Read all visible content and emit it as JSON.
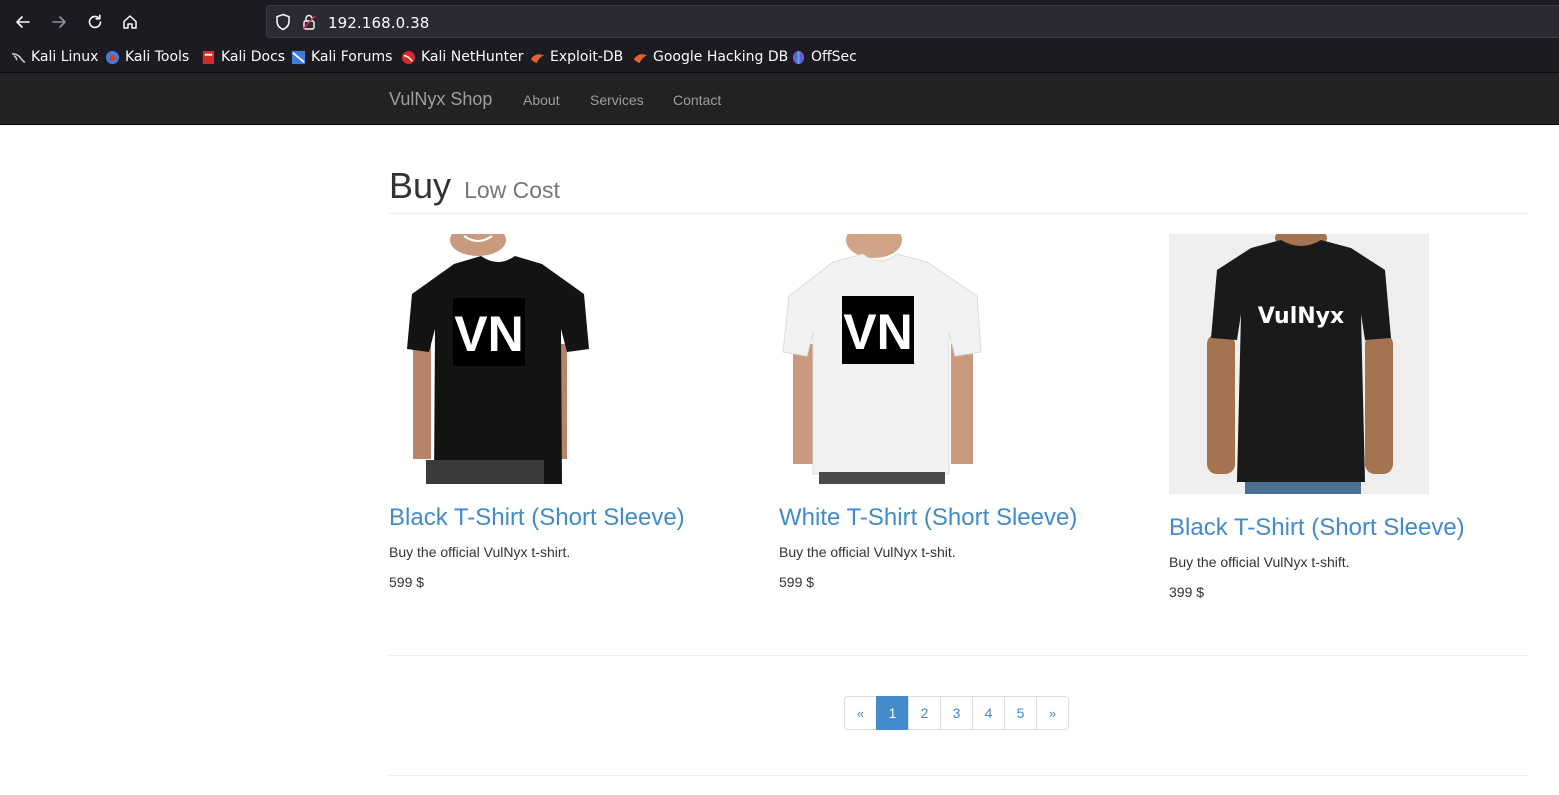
{
  "browser": {
    "url": "192.168.0.38",
    "bookmarks": [
      {
        "label": "Kali Linux",
        "icon": "kali-dragon-icon"
      },
      {
        "label": "Kali Tools",
        "icon": "kali-tools-icon"
      },
      {
        "label": "Kali Docs",
        "icon": "kali-docs-icon"
      },
      {
        "label": "Kali Forums",
        "icon": "kali-forums-icon"
      },
      {
        "label": "Kali NetHunter",
        "icon": "kali-nethunter-icon"
      },
      {
        "label": "Exploit-DB",
        "icon": "exploit-db-icon"
      },
      {
        "label": "Google Hacking DB",
        "icon": "ghdb-icon"
      },
      {
        "label": "OffSec",
        "icon": "offsec-icon"
      }
    ]
  },
  "navbar": {
    "brand": "VulNyx Shop",
    "links": [
      "About",
      "Services",
      "Contact"
    ]
  },
  "header": {
    "title": "Buy",
    "subtitle": "Low Cost"
  },
  "products": [
    {
      "name": "Black T-Shirt (Short Sleeve)",
      "description": "Buy the official VulNyx t-shirt.",
      "price": "599 $",
      "shirt_color": "#121314",
      "logo_text": "VN"
    },
    {
      "name": "White T-Shirt (Short Sleeve)",
      "description": "Buy the official VulNyx t-shit.",
      "price": "599 $",
      "shirt_color": "#f2f2f2",
      "logo_text": "VN"
    },
    {
      "name": "Black T-Shirt (Short Sleeve)",
      "description": "Buy the official VulNyx t-shift.",
      "price": "399 $",
      "shirt_color": "#1a1a1a",
      "logo_text": "VulNyx"
    }
  ],
  "pagination": {
    "prev": "«",
    "pages": [
      "1",
      "2",
      "3",
      "4",
      "5"
    ],
    "active": "1",
    "next": "»"
  },
  "colors": {
    "link": "#428bca",
    "navbar_bg": "#222222",
    "browser_bg": "#1c1b22"
  }
}
